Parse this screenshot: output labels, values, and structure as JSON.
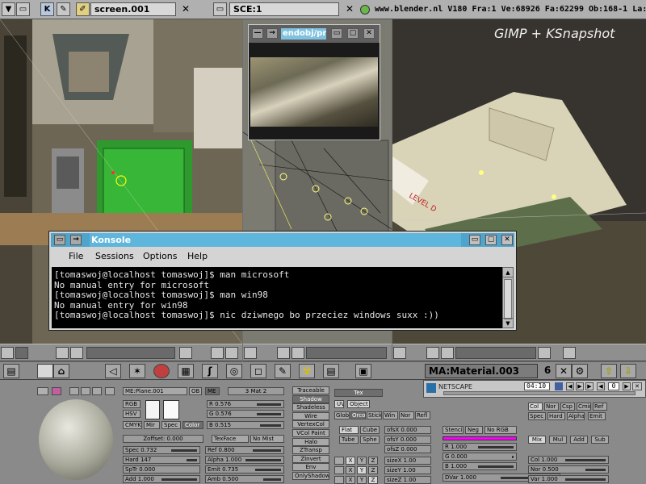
{
  "topbar": {
    "app_icon": "k-icon",
    "screen_name": "screen.001",
    "scene_name": "SCE:1",
    "blender_url": "www.blender.nl",
    "version": "V180",
    "frame": "Fra:1",
    "vertices": "Ve:68926",
    "faces": "Fa:62299",
    "objects": "Ob:168-1",
    "lamps": "La:"
  },
  "watermark": "GIMP + KSnapshot",
  "image_window": {
    "title": "endobj/pr"
  },
  "konsole": {
    "title": "Konsole",
    "menu": [
      "File",
      "Sessions",
      "Options",
      "Help"
    ],
    "lines": [
      "[tomaswoj@localhost tomaswoj]$ man microsoft",
      "No manual entry for microsoft",
      "[tomaswoj@localhost tomaswoj]$ man win98",
      "No manual entry for win98",
      "[tomaswoj@localhost tomaswoj]$ nic dziwnego bo przeciez windows suxx :))"
    ]
  },
  "mainbar": {
    "material_name": "MA:Material.003",
    "material_users": "6"
  },
  "netscape": {
    "label": "NETSCAPE",
    "time": "04:10",
    "counter": "0"
  },
  "material": {
    "mesh_name": "ME:Plane.001",
    "ob_label": "OB",
    "me_label": "ME",
    "mat_count": "3 Mat 2",
    "mode_buttons": [
      "RGB",
      "HSV",
      "CMYK"
    ],
    "mir_label": "Mir",
    "spec_label": "Spec",
    "color_label": "Color",
    "zoffset": "Zoffset: 0.000",
    "rgb": {
      "r": "R 0.576",
      "g": "G 0.576",
      "b": "B 0.515"
    },
    "texface": "TexFace",
    "nomist": "No Mist",
    "sliders_left": [
      {
        "label": "Spec 0.732",
        "fill": 0.73
      },
      {
        "label": "Hard 147",
        "fill": 0.29
      },
      {
        "label": "SpTr 0.000",
        "fill": 0.0
      },
      {
        "label": "Add 1.000",
        "fill": 1.0
      }
    ],
    "sliders_mid": [
      {
        "label": "Ref  0.800",
        "fill": 0.8
      },
      {
        "label": "Alpha 1.000",
        "fill": 1.0
      },
      {
        "label": "Emit 0.735",
        "fill": 0.73
      },
      {
        "label": "Amb  0.500",
        "fill": 0.5
      }
    ],
    "toggles": [
      "Traceable",
      "Shadow",
      "Shadeless",
      "Wire",
      "VertexCol",
      "VCol Paint",
      "Halo",
      "ZTransp",
      "ZInvert",
      "Env",
      "OnlyShadow"
    ],
    "tex_label": "Tex",
    "uv": "UV",
    "object": "Object",
    "coords": [
      "Glob",
      "Orco",
      "Stick",
      "Win",
      "Nor",
      "Refl"
    ],
    "flat": "Flat",
    "cube": "Cube",
    "tube": "Tube",
    "sphe": "Sphe",
    "ofs": [
      "ofsX 0.000",
      "ofsY 0.000",
      "ofsZ 0.000"
    ],
    "size": [
      "sizeX 1.00",
      "sizeY 1.00",
      "sizeZ 1.00"
    ],
    "stencil": "Stencil",
    "neg": "Neg",
    "norgb": "No RGB",
    "tex_rgb": {
      "r": "R 1.000",
      "g": "G 0.000",
      "b": "B 1.000"
    },
    "dvar": "DVar 1.000",
    "mapto": [
      "Col",
      "Nor",
      "Csp",
      "Cmir",
      "Ref"
    ],
    "mapto2": [
      "Spec",
      "Hard",
      "Alpha",
      "Emit"
    ],
    "blend": [
      "Mix",
      "Mul",
      "Add",
      "Sub"
    ],
    "col_slider": "Col 1.000",
    "nor_slider": "Nor 0.500",
    "var_slider": "Var 1.000"
  }
}
